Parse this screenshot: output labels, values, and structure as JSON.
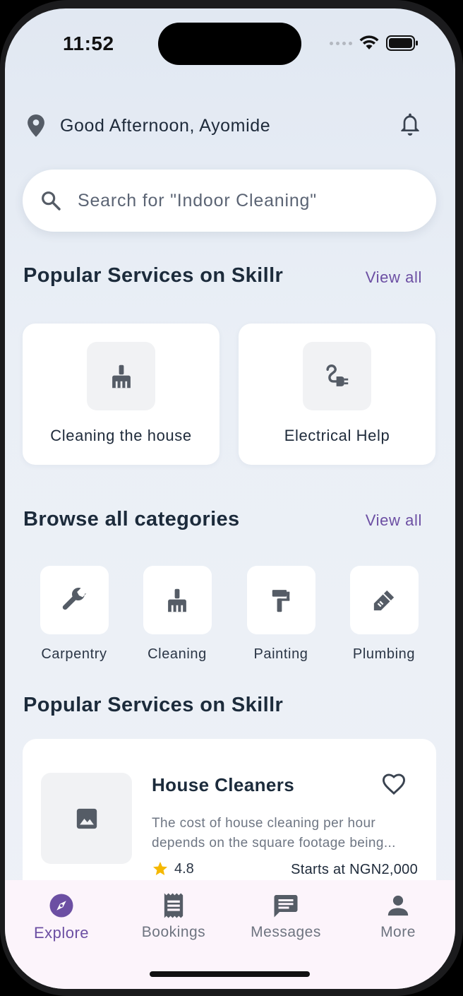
{
  "status_bar": {
    "time": "11:52"
  },
  "header": {
    "greeting": "Good Afternoon, Ayomide",
    "location_icon": "location-pin-icon",
    "notification_icon": "bell-icon"
  },
  "search": {
    "placeholder": "Search for \"Indoor Cleaning\"",
    "value": ""
  },
  "popular_section": {
    "title": "Popular Services on Skillr",
    "view_all": "View all",
    "items": [
      {
        "label": "Cleaning the house",
        "icon": "broom-icon"
      },
      {
        "label": "Electrical Help",
        "icon": "electrical-plug-icon"
      }
    ]
  },
  "categories_section": {
    "title": "Browse all categories",
    "view_all": "View all",
    "items": [
      {
        "label": "Carpentry",
        "icon": "wrench-icon"
      },
      {
        "label": "Cleaning",
        "icon": "broom-icon"
      },
      {
        "label": "Painting",
        "icon": "paint-roller-icon"
      },
      {
        "label": "Plumbing",
        "icon": "plumbing-icon"
      }
    ]
  },
  "services_section": {
    "title": "Popular Services on Skillr",
    "cards": [
      {
        "title": "House Cleaners",
        "description_line1": "The cost of house cleaning per hour",
        "description_line2": "depends on the square footage being...",
        "rating": "4.8",
        "price": "Starts at NGN2,000",
        "image_icon": "image-placeholder-icon",
        "favorite_icon": "heart-outline-icon"
      }
    ]
  },
  "tab_bar": {
    "active": "Explore",
    "tabs": [
      {
        "label": "Explore",
        "icon": "compass-icon"
      },
      {
        "label": "Bookings",
        "icon": "receipt-icon"
      },
      {
        "label": "Messages",
        "icon": "message-icon"
      },
      {
        "label": "More",
        "icon": "person-icon"
      }
    ]
  },
  "colors": {
    "accent": "#6c4fa3",
    "text_dark": "#1c2b3b",
    "icon_gray": "#555c66",
    "star": "#f5b800"
  }
}
